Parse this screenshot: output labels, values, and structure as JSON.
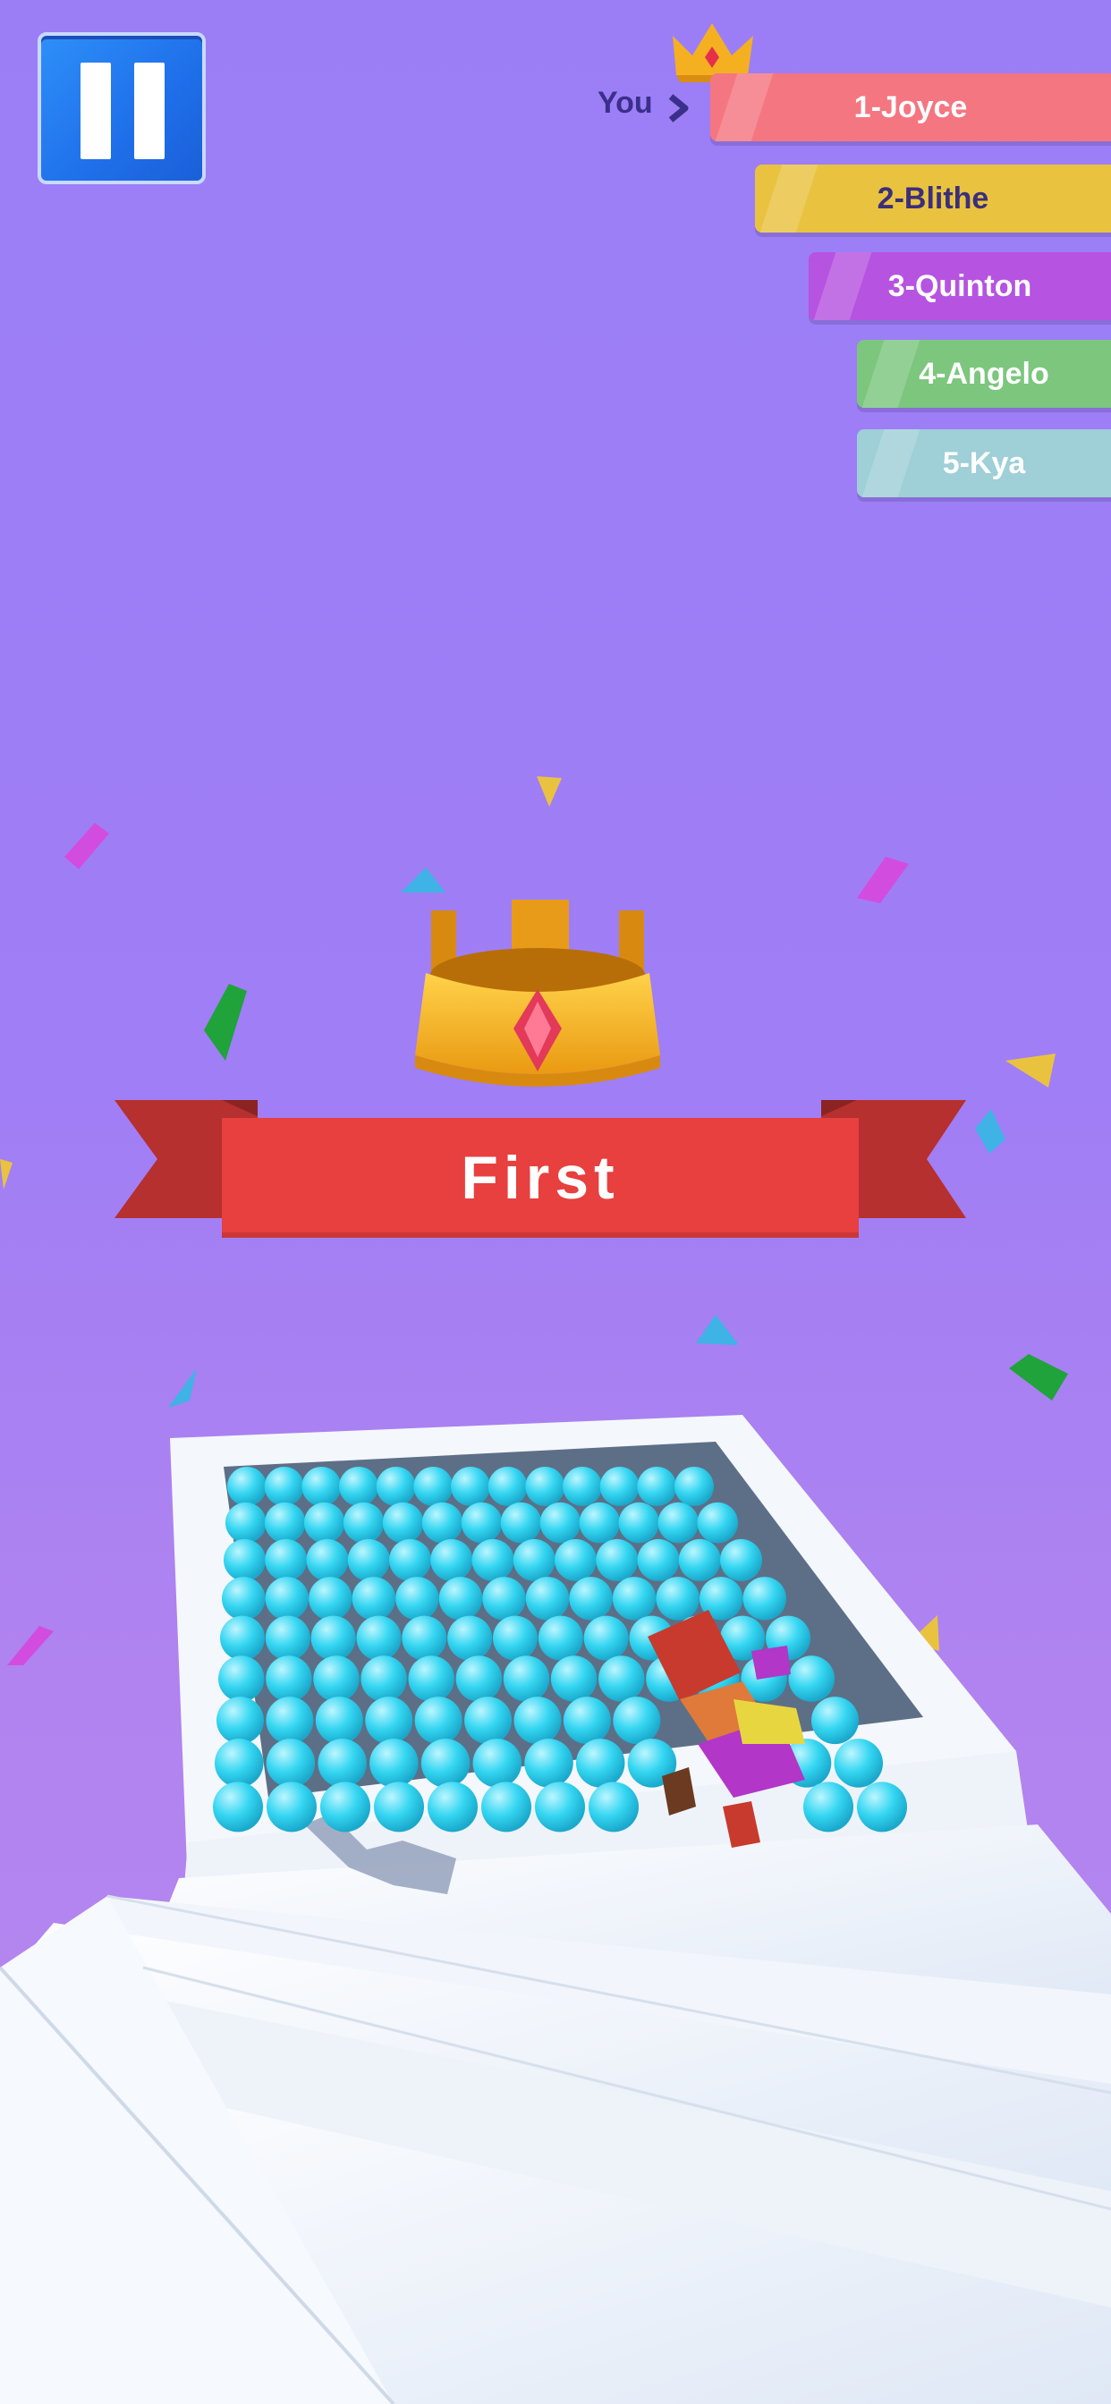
{
  "hud": {
    "pause_icon": "pause-icon",
    "you_label": "You"
  },
  "leaderboard": [
    {
      "label": "1-Joyce",
      "color": "#f47681",
      "text_color": "#ffffff"
    },
    {
      "label": "2-Blithe",
      "color": "#e9c340",
      "text_color": "#3b2f7a"
    },
    {
      "label": "3-Quinton",
      "color": "#b653e0",
      "text_color": "#ffffff"
    },
    {
      "label": "4-Angelo",
      "color": "#7cc67e",
      "text_color": "#ffffff"
    },
    {
      "label": "5-Kya",
      "color": "#9fcfd7",
      "text_color": "#ffffff"
    }
  ],
  "result": {
    "rank_text": "First",
    "ribbon_color": "#e83f3f",
    "crown_icon": "crown-icon"
  },
  "colors": {
    "background_top": "#9b7ef6",
    "background_bottom": "#b989ee",
    "balls": "#35d6f2"
  }
}
